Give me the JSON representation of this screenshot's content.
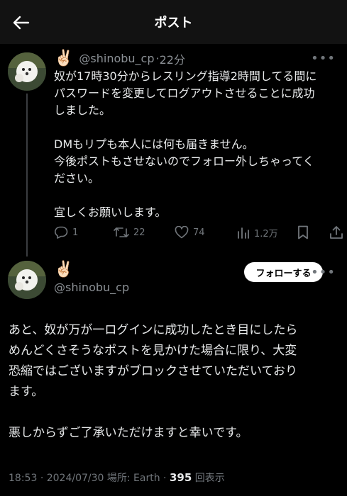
{
  "header": {
    "title": "ポスト"
  },
  "post1": {
    "emoji": "✌🏻",
    "handle": "@shinobu_cp",
    "separator": "·",
    "time": "22分",
    "body_lines": [
      "奴が17時30分からレスリング指導2時間してる間に",
      "パスワードを変更してログアウトさせることに成功",
      "しました。",
      "DMもリプも本人には何も届きません。",
      "今後ポストもさせないのでフォロー外しちゃってく",
      "ださい。",
      "宜しくお願いします。"
    ],
    "actions": {
      "reply_count": "1",
      "retweet_count": "22",
      "like_count": "74",
      "view_count": "1.2万"
    }
  },
  "post2": {
    "emoji": "✌🏻",
    "handle": "@shinobu_cp",
    "follow_label": "フォローする",
    "body_lines": [
      "あと、奴が万が一ログインに成功したとき目にしたら",
      "めんどくさそうなポストを見かけた場合に限り、大変",
      "恐縮ではございますがブロックさせていただいており",
      "ます。",
      "悪しからずご了承いただけますと幸いです。"
    ],
    "meta": {
      "time": "18:53",
      "date": "2024/07/30",
      "location": "場所: Earth",
      "views": "395",
      "views_label": "回表示"
    }
  }
}
